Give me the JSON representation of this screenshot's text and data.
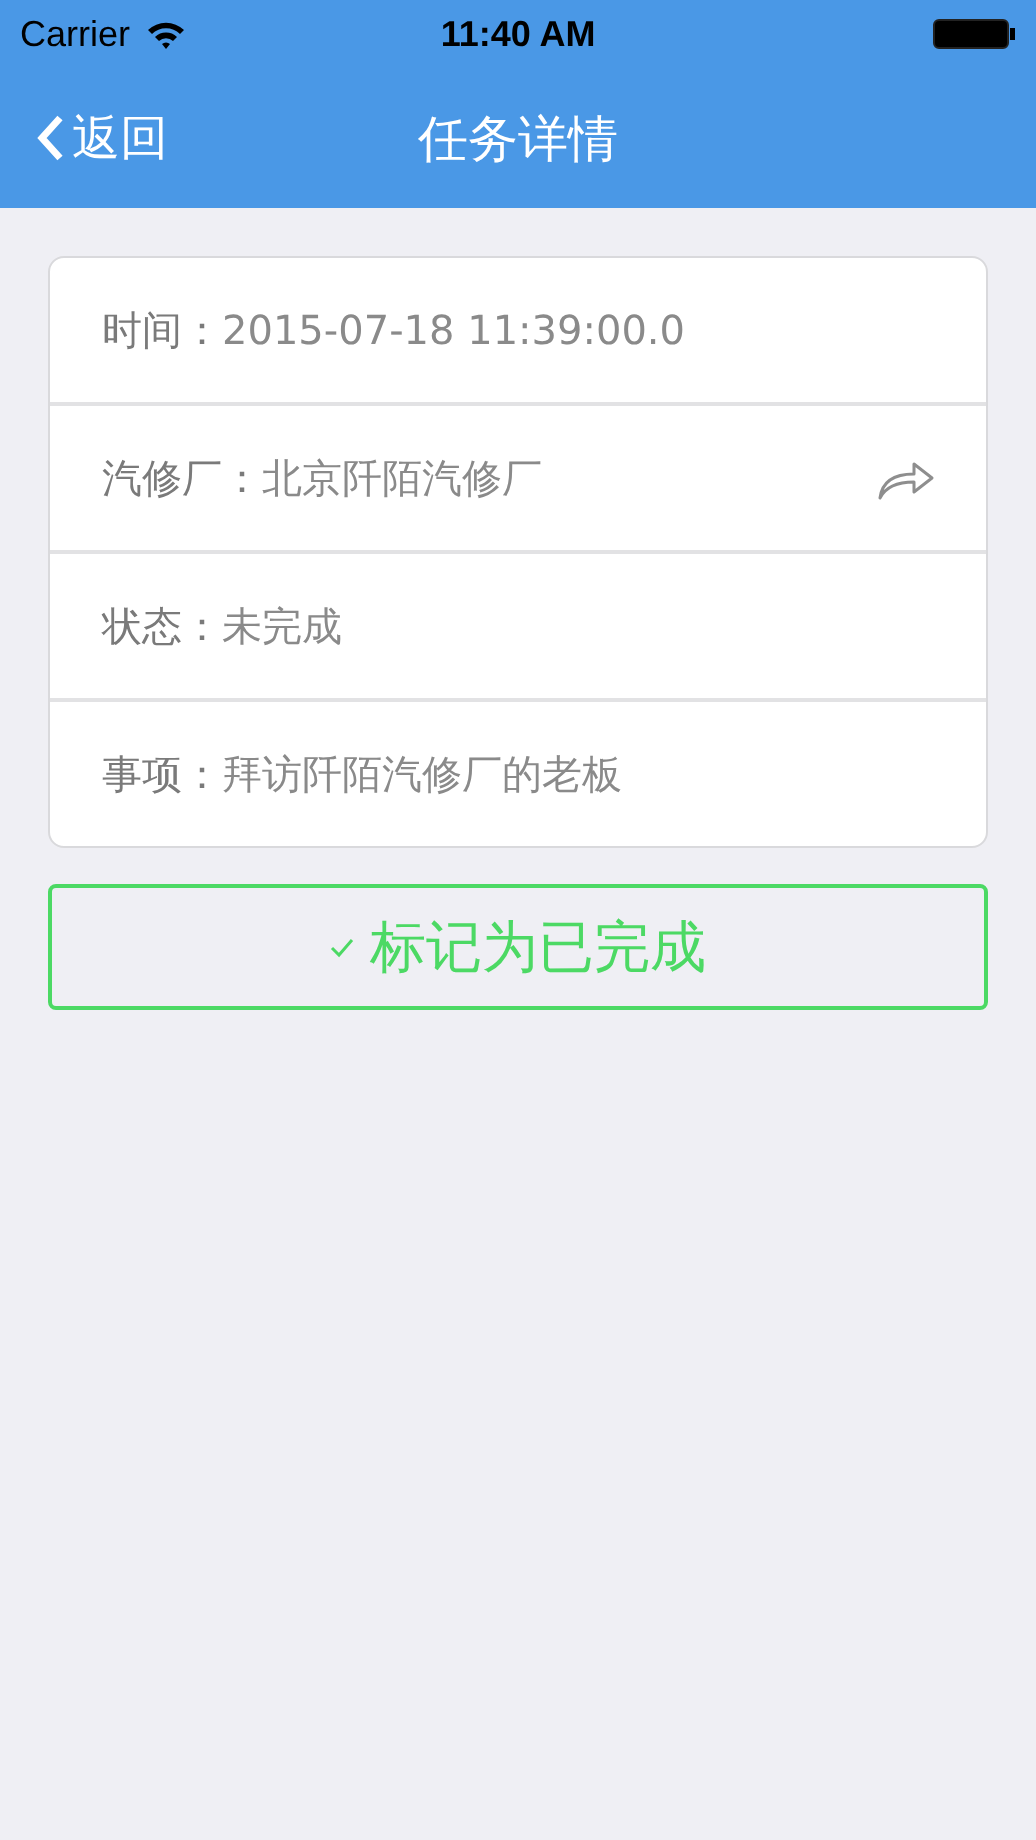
{
  "status_bar": {
    "carrier": "Carrier",
    "time": "11:40 AM"
  },
  "nav_bar": {
    "back": "返回",
    "title": "任务详情"
  },
  "details": [
    {
      "label": "时间：",
      "value": "2015-07-18 11:39:00.0",
      "shareable": false
    },
    {
      "label": "汽修厂：",
      "value": "北京阡陌汽修厂",
      "shareable": true
    },
    {
      "label": "状态：",
      "value": "未完成",
      "shareable": false
    },
    {
      "label": "事项：",
      "value": "拜访阡陌汽修厂的老板",
      "shareable": false
    }
  ],
  "complete_button": {
    "label": "标记为已完成"
  }
}
